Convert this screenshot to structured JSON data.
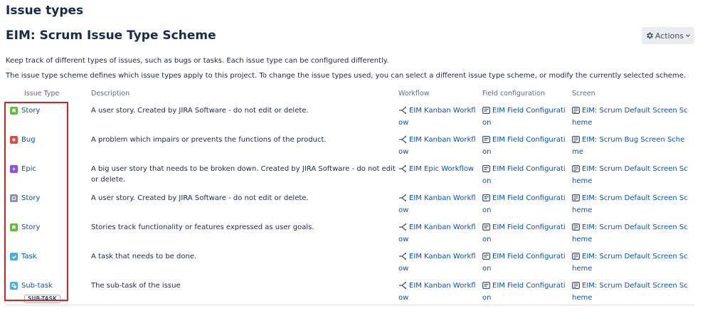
{
  "page": {
    "heading": "Issue types",
    "scheme_title": "EIM: Scrum Issue Type Scheme",
    "actions_label": "Actions",
    "description_1": "Keep track of different types of issues, such as bugs or tasks. Each issue type can be configured differently.",
    "description_2": "The issue type scheme defines which issue types apply to this project. To change the issue types used, you can select a different issue type scheme, or modify the currently selected scheme."
  },
  "table": {
    "headers": {
      "issue_type": "Issue Type",
      "description": "Description",
      "workflow": "Workflow",
      "field_configuration": "Field configuration",
      "screen": "Screen"
    },
    "rows": [
      {
        "name": "Story",
        "icon": "story-icon",
        "description": "A user story. Created by JIRA Software - do not edit or delete.",
        "workflow": "EIM Kanban Workflow",
        "field_config": "EIM Field Configuration",
        "screen": "EIM: Scrum Default Screen Scheme"
      },
      {
        "name": "Bug",
        "icon": "bug-icon",
        "description": "A problem which impairs or prevents the functions of the product.",
        "workflow": "EIM Kanban Workflow",
        "field_config": "EIM Field Configuration",
        "screen": "EIM: Scrum Bug Screen Scheme"
      },
      {
        "name": "Epic",
        "icon": "epic-icon",
        "description": "A big user story that needs to be broken down. Created by JIRA Software - do not edit or delete.",
        "workflow": "EIM Epic Workflow",
        "field_config": "EIM Field Configuration",
        "screen": "EIM: Scrum Default Screen Scheme"
      },
      {
        "name": "Story",
        "icon": "story-grey-icon",
        "description": "A user story. Created by JIRA Software - do not edit or delete.",
        "workflow": "EIM Kanban Workflow",
        "field_config": "EIM Field Configuration",
        "screen": "EIM: Scrum Default Screen Scheme"
      },
      {
        "name": "Story",
        "icon": "story-icon",
        "description": "Stories track functionality or features expressed as user goals.",
        "workflow": "EIM Kanban Workflow",
        "field_config": "EIM Field Configuration",
        "screen": "EIM: Scrum Default Screen Scheme"
      },
      {
        "name": "Task",
        "icon": "task-icon",
        "description": "A task that needs to be done.",
        "workflow": "EIM Kanban Workflow",
        "field_config": "EIM Field Configuration",
        "screen": "EIM: Scrum Default Screen Scheme"
      },
      {
        "name": "Sub-task",
        "icon": "subtask-icon",
        "badge": "SUB-TASK",
        "description": "The sub-task of the issue",
        "workflow": "EIM Kanban Workflow",
        "field_config": "EIM Field Configuration",
        "screen": "EIM: Scrum Default Screen Scheme"
      }
    ]
  },
  "colors": {
    "link": "#0052cc",
    "story": "#63ba3c",
    "bug": "#e5493a",
    "epic": "#904ee2",
    "story_grey": "#8993a4",
    "task": "#4bade8",
    "subtask": "#4bade8",
    "highlight": "#e02020"
  }
}
